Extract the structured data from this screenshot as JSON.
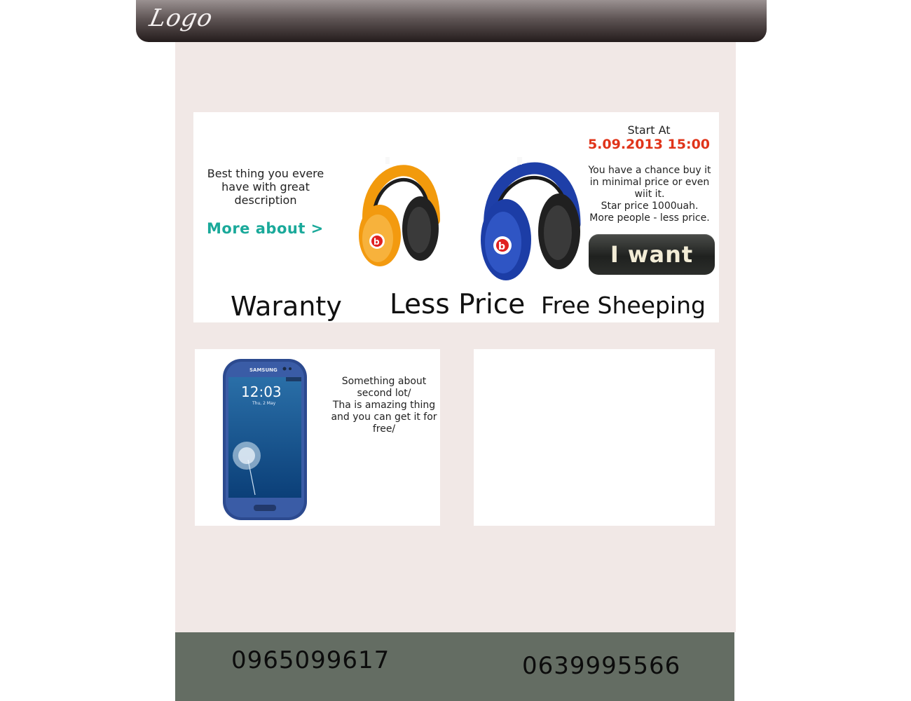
{
  "header": {
    "logo_text": "Logo"
  },
  "banner": {
    "description": "Best thing you evere have with great description",
    "more_link": "More about >",
    "start_label": "Start At",
    "start_datetime": "5.09.2013 15:00",
    "promo_lines": [
      "You have a chance buy it in minimal price or even wiit it.",
      "Star price 1000uah.",
      "More people - less price."
    ],
    "cta_label": "I want",
    "features": [
      "Waranty",
      "Less Price",
      "Free Sheeping"
    ],
    "images": [
      "orange-headphones",
      "blue-headphones"
    ]
  },
  "lots": [
    {
      "image": "blue-smartphone",
      "text_lines": [
        "Something about second lot/",
        "Tha is amazing thing and you can get it for free/"
      ]
    },
    {
      "image": null,
      "text_lines": []
    }
  ],
  "footer": {
    "phones": [
      "0965099617",
      "0639995566"
    ]
  },
  "colors": {
    "accent_teal": "#1aa99a",
    "date_red": "#e0341a",
    "page_bg": "#f1e8e6",
    "footer_bg": "#646d63"
  }
}
